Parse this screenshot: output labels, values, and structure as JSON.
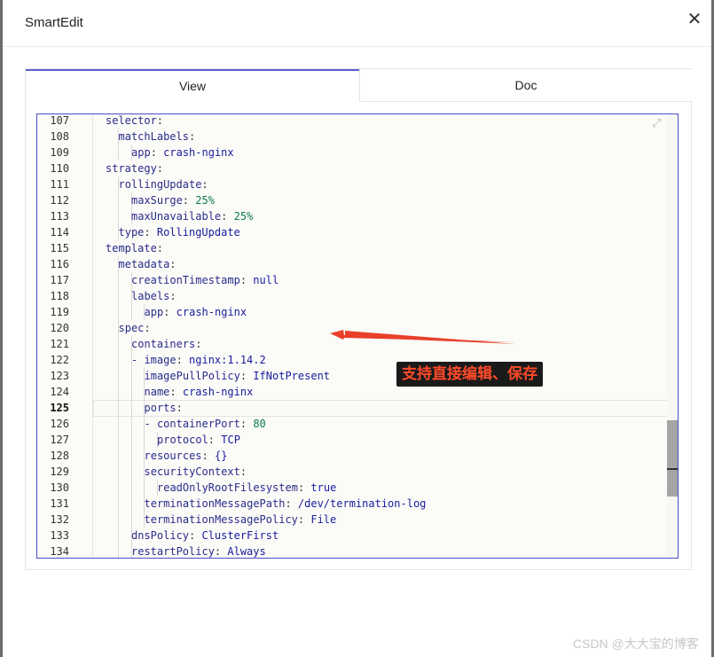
{
  "dialog": {
    "title": "SmartEdit",
    "close_glyph": "✕"
  },
  "tabs": [
    {
      "label": "View",
      "active": true
    },
    {
      "label": "Doc",
      "active": false
    }
  ],
  "editor": {
    "active_line": 125,
    "lines": [
      {
        "n": "107",
        "indent": 0,
        "key": "selector",
        "sep": ":",
        "val": "",
        "vtype": ""
      },
      {
        "n": "108",
        "indent": 1,
        "key": "matchLabels",
        "sep": ":",
        "val": "",
        "vtype": ""
      },
      {
        "n": "109",
        "indent": 2,
        "key": "app",
        "sep": ": ",
        "val": "crash-nginx",
        "vtype": "val"
      },
      {
        "n": "110",
        "indent": 0,
        "key": "strategy",
        "sep": ":",
        "val": "",
        "vtype": ""
      },
      {
        "n": "111",
        "indent": 1,
        "key": "rollingUpdate",
        "sep": ":",
        "val": "",
        "vtype": ""
      },
      {
        "n": "112",
        "indent": 2,
        "key": "maxSurge",
        "sep": ": ",
        "val": "25%",
        "vtype": "num"
      },
      {
        "n": "113",
        "indent": 2,
        "key": "maxUnavailable",
        "sep": ": ",
        "val": "25%",
        "vtype": "num"
      },
      {
        "n": "114",
        "indent": 1,
        "key": "type",
        "sep": ": ",
        "val": "RollingUpdate",
        "vtype": "val"
      },
      {
        "n": "115",
        "indent": 0,
        "key": "template",
        "sep": ":",
        "val": "",
        "vtype": ""
      },
      {
        "n": "116",
        "indent": 1,
        "key": "metadata",
        "sep": ":",
        "val": "",
        "vtype": ""
      },
      {
        "n": "117",
        "indent": 2,
        "key": "creationTimestamp",
        "sep": ": ",
        "val": "null",
        "vtype": "kw"
      },
      {
        "n": "118",
        "indent": 2,
        "key": "labels",
        "sep": ":",
        "val": "",
        "vtype": ""
      },
      {
        "n": "119",
        "indent": 3,
        "key": "app",
        "sep": ": ",
        "val": "crash-nginx",
        "vtype": "val"
      },
      {
        "n": "120",
        "indent": 1,
        "key": "spec",
        "sep": ":",
        "val": "",
        "vtype": ""
      },
      {
        "n": "121",
        "indent": 2,
        "key": "containers",
        "sep": ":",
        "val": "",
        "vtype": ""
      },
      {
        "n": "122",
        "indent": 2,
        "key": "- image",
        "sep": ": ",
        "val": "nginx:1.14.2",
        "vtype": "val"
      },
      {
        "n": "123",
        "indent": 3,
        "key": "imagePullPolicy",
        "sep": ": ",
        "val": "IfNotPresent",
        "vtype": "val"
      },
      {
        "n": "124",
        "indent": 3,
        "key": "name",
        "sep": ": ",
        "val": "crash-nginx",
        "vtype": "val"
      },
      {
        "n": "125",
        "indent": 3,
        "key": "ports",
        "sep": ":",
        "val": "",
        "vtype": ""
      },
      {
        "n": "126",
        "indent": 3,
        "key": "- containerPort",
        "sep": ": ",
        "val": "80",
        "vtype": "num"
      },
      {
        "n": "127",
        "indent": 4,
        "key": "protocol",
        "sep": ": ",
        "val": "TCP",
        "vtype": "val"
      },
      {
        "n": "128",
        "indent": 3,
        "key": "resources",
        "sep": ": ",
        "val": "{}",
        "vtype": "kw"
      },
      {
        "n": "129",
        "indent": 3,
        "key": "securityContext",
        "sep": ":",
        "val": "",
        "vtype": ""
      },
      {
        "n": "130",
        "indent": 4,
        "key": "readOnlyRootFilesystem",
        "sep": ": ",
        "val": "true",
        "vtype": "kw"
      },
      {
        "n": "131",
        "indent": 3,
        "key": "terminationMessagePath",
        "sep": ": ",
        "val": "/dev/termination-log",
        "vtype": "val"
      },
      {
        "n": "132",
        "indent": 3,
        "key": "terminationMessagePolicy",
        "sep": ": ",
        "val": "File",
        "vtype": "val"
      },
      {
        "n": "133",
        "indent": 2,
        "key": "dnsPolicy",
        "sep": ": ",
        "val": "ClusterFirst",
        "vtype": "val"
      },
      {
        "n": "134",
        "indent": 2,
        "key": "restartPolicy",
        "sep": ": ",
        "val": "Always",
        "vtype": "val"
      }
    ]
  },
  "annotation": {
    "text": "支持直接编辑、保存",
    "color": "#ff4a2a"
  },
  "watermark": "CSDN @大大宝的博客",
  "colors": {
    "accent": "#4b4fc4",
    "arrow": "#e8402a"
  }
}
